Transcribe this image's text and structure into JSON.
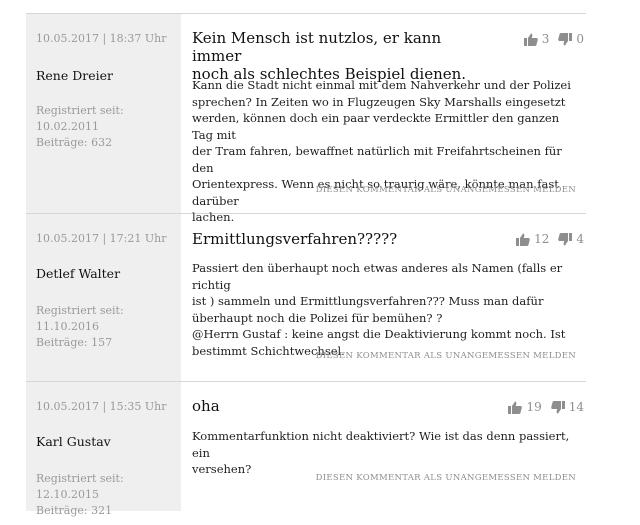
{
  "report_label": "DIESEN KOMMENTAR ALS UNANGEMESSEN MELDEN",
  "comments": [
    {
      "date": "10.05.2017 | 18:37 Uhr",
      "author": "Rene Dreier",
      "registered": "Registriert seit: 10.02.2011",
      "posts": "Beiträge: 632",
      "title_lines": [
        "Kein Mensch ist nutzlos, er kann immer",
        "noch als schlechtes Beispiel dienen."
      ],
      "text_lines": [
        "Kann die Stadt nicht einmal mit dem Nahverkehr und der Polizei",
        "sprechen? In Zeiten wo in Flugzeugen Sky Marshalls eingesetzt",
        "werden, können doch ein paar verdeckte Ermittler den ganzen Tag mit",
        "der Tram fahren, bewaffnet natürlich mit Freifahrtscheinen für den",
        "Orientexpress. Wenn es nicht so traurig wäre, könnte man fast darüber",
        "lachen."
      ],
      "upvotes": "3",
      "downvotes": "0"
    },
    {
      "date": "10.05.2017 | 17:21 Uhr",
      "author": "Detlef Walter",
      "registered": "Registriert seit: 11.10.2016",
      "posts": "Beiträge: 157",
      "title_lines": [
        "Ermittlungsverfahren?????"
      ],
      "text_lines": [
        "Passiert den überhaupt noch etwas anderes als Namen (falls er richtig",
        "ist ) sammeln und Ermittlungsverfahren??? Muss man dafür",
        "überhaupt noch die Polizei für bemühen? ?",
        "@Herrn Gustaf : keine angst die Deaktivierung kommt noch. Ist",
        "bestimmt Schichtwechsel."
      ],
      "upvotes": "12",
      "downvotes": "4"
    },
    {
      "date": "10.05.2017 | 15:35 Uhr",
      "author": "Karl Gustav",
      "registered": "Registriert seit: 12.10.2015",
      "posts": "Beiträge: 321",
      "title_lines": [
        "oha"
      ],
      "text_lines": [
        "Kommentarfunktion nicht deaktiviert? Wie ist das denn passiert, ein",
        "versehen?"
      ],
      "upvotes": "19",
      "downvotes": "14"
    }
  ]
}
